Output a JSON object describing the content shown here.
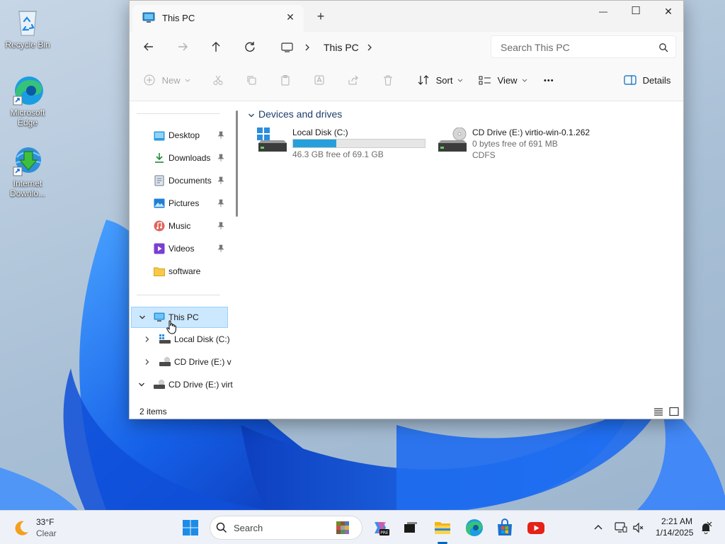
{
  "desktop": {
    "icons": [
      {
        "label": "Recycle Bin"
      },
      {
        "label": "Microsoft Edge"
      },
      {
        "label": "Internet Downlo..."
      }
    ]
  },
  "window": {
    "tab_title": "This PC",
    "tab_close": "✕",
    "new_tab": "+",
    "controls": {
      "minimize": "—",
      "maximize": "☐",
      "close": "✕"
    },
    "address": {
      "location": "This PC"
    },
    "search": {
      "placeholder": "Search This PC"
    },
    "toolbar": {
      "new_label": "New",
      "sort_label": "Sort",
      "view_label": "View",
      "more_label": "•••",
      "details_label": "Details"
    },
    "nav": {
      "quick_access": [
        {
          "label": "Desktop"
        },
        {
          "label": "Downloads"
        },
        {
          "label": "Documents"
        },
        {
          "label": "Pictures"
        },
        {
          "label": "Music"
        },
        {
          "label": "Videos"
        },
        {
          "label": "software"
        }
      ],
      "this_pc": "This PC",
      "local_disk": "Local Disk (C:)",
      "cd_drive_child": "CD Drive (E:) v",
      "cd_drive_root": "CD Drive (E:) virt"
    },
    "content": {
      "group_title": "Devices and drives",
      "drives": [
        {
          "name": "Local Disk (C:)",
          "space": "46.3 GB free of 69.1 GB",
          "used_fraction": 0.33
        },
        {
          "name": "CD Drive (E:) virtio-win-0.1.262",
          "space": "0 bytes free of 691 MB",
          "fs": "CDFS"
        }
      ]
    },
    "status": {
      "items": "2 items"
    }
  },
  "taskbar": {
    "weather": {
      "temp": "33°F",
      "condition": "Clear"
    },
    "search_label": "Search",
    "clock": {
      "time": "2:21 AM",
      "date": "1/14/2025"
    }
  },
  "colors": {
    "accent": "#0067c0",
    "selection": "#cce8ff",
    "bar": "#26a0da"
  }
}
